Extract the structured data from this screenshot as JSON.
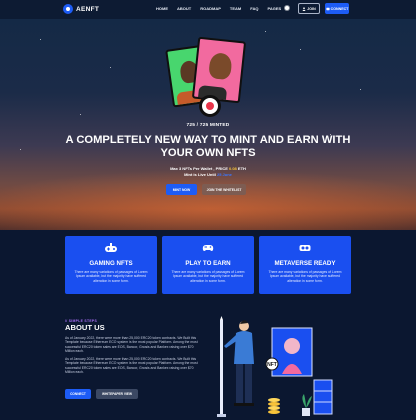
{
  "brand": {
    "logo_text": "AENFT"
  },
  "nav": {
    "items": [
      {
        "label": "HOME"
      },
      {
        "label": "ABOUT"
      },
      {
        "label": "ROADMAP"
      },
      {
        "label": "TEAM"
      },
      {
        "label": "FAQ"
      },
      {
        "label": "PAGES"
      }
    ],
    "theme_icon": "sun-icon",
    "join_label": "JOIN",
    "connect_label": "CONNECT"
  },
  "hero": {
    "minted": "725 / 725 MINTED",
    "headline": "A COMPLETELY NEW WAY TO MINT AND EARN WITH YOUR OWN NFTS",
    "max_prefix": "Max 3 NFTs Per Wallet , PRICE",
    "max_price": "0.08",
    "max_suffix": "ETH",
    "live_prefix": "Mint is Live Until",
    "live_link": "25 June",
    "mint_button": "MINT NOW",
    "whitelist_button": "JOIN THE WHITELIST",
    "colors": {
      "accent": "#1d5cf5",
      "price": "#f7c33a"
    }
  },
  "features": [
    {
      "icon": "gamepad-icon",
      "title": "GAMING NFTS",
      "desc": "There are many variations of passages of Lorem Ipsum available, but the majority have suffered alteration in some form."
    },
    {
      "icon": "controller-icon",
      "title": "PLAY TO EARN",
      "desc": "There are many variations of passages of Lorem Ipsum available, but the majority have suffered alteration in some form."
    },
    {
      "icon": "vr-headset-icon",
      "title": "METAVERSE READY",
      "desc": "There are many variations of passages of Lorem Ipsum available, but the majority have suffered alteration in some form."
    }
  ],
  "about": {
    "eyebrow": "// SIMPLE STEPS",
    "title": "ABOUT US",
    "p1": "As of January 2022, there were more than 25,000 ERC20 token contracts. We Built this Template because Ethereum ECO system is the most popular Platform. Among the most successful ERC20 token sales are EOS, Bancor, Gnosis and Bankex raising over $70 Million each.",
    "p2": "As of January 2022, there were more than 25,000 ERC20 token contracts. We Built this Template because Ethereum ECO system is the most popular Platform. Among the most successful ERC20 token sales are EOS, Bancor, Gnosis and Bankex raising over $70 Million each.",
    "contact_button": "CONNECT",
    "whitepaper_button": "WHITEPAPER VIEW",
    "colors": {
      "eyebrow": "#a76ef5",
      "feature_bg": "#1a4ff0"
    }
  }
}
